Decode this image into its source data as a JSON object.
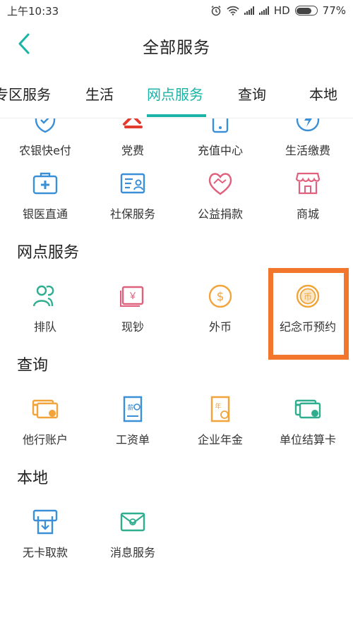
{
  "status": {
    "time": "上午10:33",
    "network": "HD",
    "battery": "77%",
    "battery_level": 0.77
  },
  "header": {
    "title": "全部服务"
  },
  "tabs": [
    {
      "label": "专区服务",
      "active": false
    },
    {
      "label": "生活",
      "active": false
    },
    {
      "label": "网点服务",
      "active": true
    },
    {
      "label": "查询",
      "active": false
    },
    {
      "label": "本地",
      "active": false
    }
  ],
  "life_items": [
    {
      "label": "农银快e付",
      "icon": "shield-icon"
    },
    {
      "label": "党费",
      "icon": "party-icon"
    },
    {
      "label": "充值中心",
      "icon": "phone-icon"
    },
    {
      "label": "生活缴费",
      "icon": "bolt-icon"
    },
    {
      "label": "银医直通",
      "icon": "medical-kit-icon"
    },
    {
      "label": "社保服务",
      "icon": "id-card-icon"
    },
    {
      "label": "公益捐款",
      "icon": "handshake-heart-icon"
    },
    {
      "label": "商城",
      "icon": "shop-icon"
    }
  ],
  "sections": {
    "branch": "网点服务",
    "query": "查询",
    "local": "本地"
  },
  "branch_items": [
    {
      "label": "排队",
      "icon": "queue-people-icon"
    },
    {
      "label": "现钞",
      "icon": "banknote-icon"
    },
    {
      "label": "外币",
      "icon": "dollar-coin-icon"
    },
    {
      "label": "纪念币预约",
      "icon": "commemorative-coin-icon"
    }
  ],
  "query_items": [
    {
      "label": "他行账户",
      "icon": "cards-icon"
    },
    {
      "label": "工资单",
      "icon": "payslip-icon"
    },
    {
      "label": "企业年金",
      "icon": "annuity-icon"
    },
    {
      "label": "单位结算卡",
      "icon": "settlement-card-icon"
    }
  ],
  "local_items": [
    {
      "label": "无卡取款",
      "icon": "atm-withdraw-icon"
    },
    {
      "label": "消息服务",
      "icon": "message-envelope-icon"
    }
  ],
  "colors": {
    "accent": "#1bb3a6",
    "highlight": "#f2762b",
    "blue": "#3a8fd6",
    "orange": "#f0a43a",
    "pink": "#e0607e",
    "red": "#e23b2e",
    "green": "#2fae8f"
  },
  "pua_coin": "币",
  "pua_year": "年",
  "pua_salary": "薪",
  "pua_yen": "￥"
}
